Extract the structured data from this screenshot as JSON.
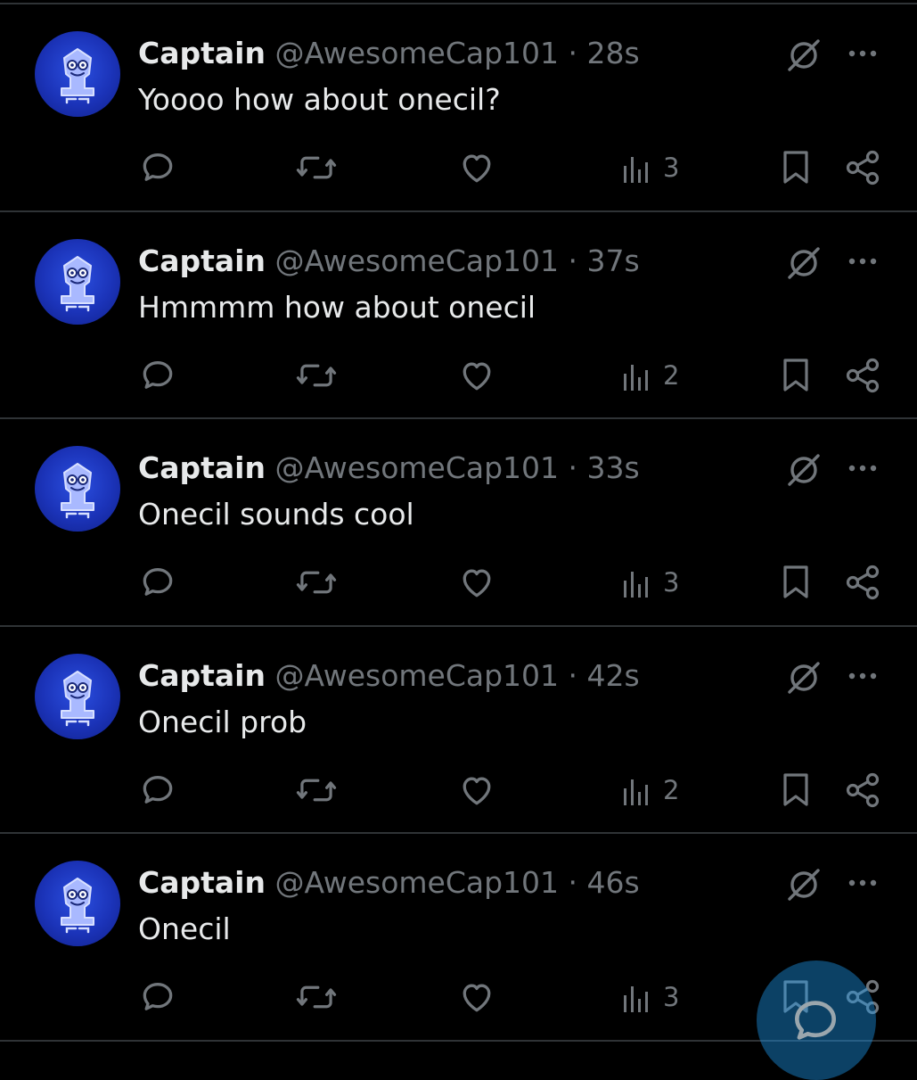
{
  "posts": [
    {
      "name": "Captain",
      "handle": "@AwesomeCap101",
      "separator": "·",
      "time": "28s",
      "text": "Yoooo how about onecil?",
      "views": "3"
    },
    {
      "name": "Captain",
      "handle": "@AwesomeCap101",
      "separator": "·",
      "time": "37s",
      "text": "Hmmmm how about onecil",
      "views": "2"
    },
    {
      "name": "Captain",
      "handle": "@AwesomeCap101",
      "separator": "·",
      "time": "33s",
      "text": "Onecil sounds cool",
      "views": "3"
    },
    {
      "name": "Captain",
      "handle": "@AwesomeCap101",
      "separator": "·",
      "time": "42s",
      "text": "Onecil prob",
      "views": "2"
    },
    {
      "name": "Captain",
      "handle": "@AwesomeCap101",
      "separator": "·",
      "time": "46s",
      "text": "Onecil",
      "views": "3"
    }
  ],
  "icons": {
    "avatar": "avatar-mascot-icon",
    "grok": "grok-icon",
    "more": "more-options-icon",
    "reply": "reply-icon",
    "repost": "repost-icon",
    "like": "like-icon",
    "views": "views-icon",
    "bookmark": "bookmark-icon",
    "share": "share-icon",
    "compose": "compose-reply-icon"
  },
  "colors": {
    "background": "#000000",
    "primary_text": "#e7e9ea",
    "secondary_text": "#71767b",
    "divider": "#2f3336",
    "avatar_blue": "#1b33b8",
    "fab_accent": "#1d9bf0"
  }
}
